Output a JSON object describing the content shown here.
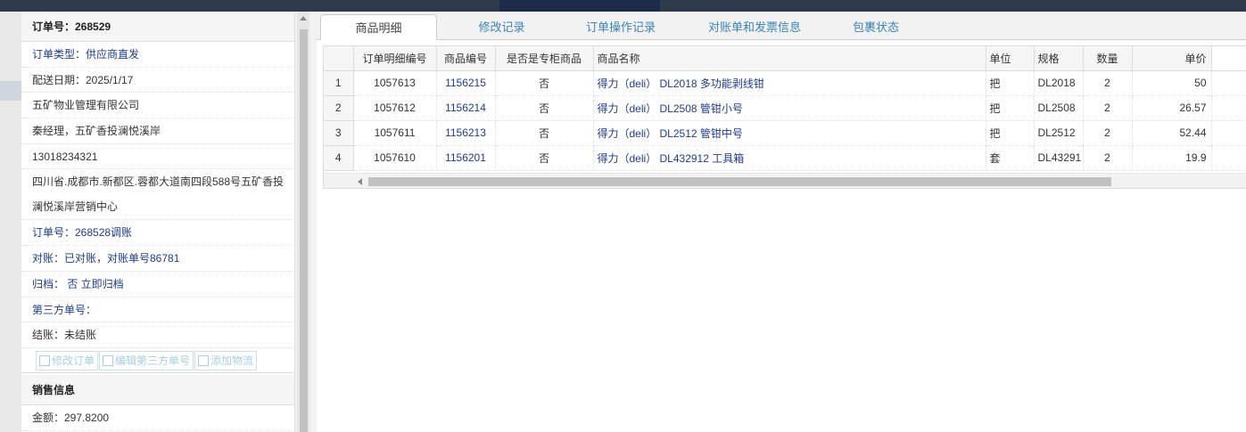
{
  "order": {
    "title": "订单号：268529",
    "rows": [
      {
        "text": "订单类型：供应商直发",
        "style": "blue"
      },
      {
        "text": "配送日期：2025/1/17",
        "style": ""
      },
      {
        "text": "五矿物业管理有限公司",
        "style": ""
      },
      {
        "text": "秦经理，五矿香投澜悦溪岸",
        "style": ""
      },
      {
        "text": "13018234321",
        "style": ""
      },
      {
        "text": "四川省.成都市.新都区.蓉都大道南四段588号五矿香投澜悦溪岸营销中心",
        "style": "tall"
      },
      {
        "text": "订单号：268528调账",
        "style": "blue"
      },
      {
        "text": "对账：已对账，对账单号86781",
        "style": "blue"
      },
      {
        "text": "归档： 否 立即归档",
        "style": "blue"
      },
      {
        "text": "第三方单号：",
        "style": "blue"
      },
      {
        "text": "结账：未结账",
        "style": ""
      }
    ],
    "buttons": [
      "修改订单",
      "编辑第三方单号",
      "添加物流"
    ]
  },
  "sales": {
    "title": "销售信息",
    "amount": "金额：297.8200"
  },
  "tabs": [
    "商品明细",
    "修改记录",
    "订单操作记录",
    "对账单和发票信息",
    "包裹状态"
  ],
  "active_tab": 0,
  "grid": {
    "headers": [
      "",
      "订单明细编号",
      "商品编号",
      "是否是专柜商品",
      "商品名称",
      "单位",
      "规格",
      "数量",
      "单价"
    ],
    "rows": [
      [
        "1",
        "1057613",
        "1156215",
        "否",
        "得力（deli） DL2018 多功能剥线钳",
        "把",
        "DL2018",
        "2",
        "50"
      ],
      [
        "2",
        "1057612",
        "1156214",
        "否",
        "得力（deli） DL2508 管钳小号",
        "把",
        "DL2508",
        "2",
        "26.57"
      ],
      [
        "3",
        "1057611",
        "1156213",
        "否",
        "得力（deli） DL2512 管钳中号",
        "把",
        "DL2512",
        "2",
        "52.44"
      ],
      [
        "4",
        "1057610",
        "1156201",
        "否",
        "得力（deli） DL432912 工具箱",
        "套",
        "DL43291",
        "2",
        "19.9"
      ]
    ]
  },
  "colors": {
    "link": "#1f3b8c",
    "tab_text": "#3a84b7",
    "topbar": "#2e3a4a"
  }
}
